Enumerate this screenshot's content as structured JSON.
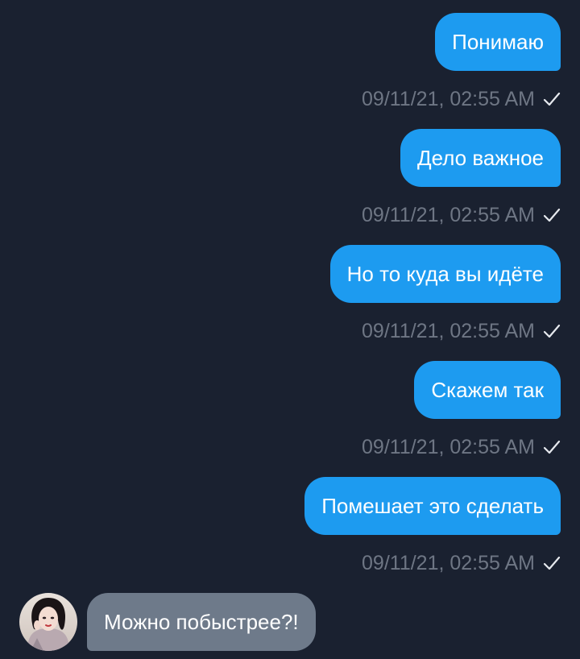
{
  "messages": [
    {
      "text": "Понимаю",
      "timestamp": "09/11/21, 02:55 AM",
      "status_icon": "check-icon"
    },
    {
      "text": "Дело важное",
      "timestamp": "09/11/21, 02:55 AM",
      "status_icon": "check-icon"
    },
    {
      "text": "Но то куда вы идёте",
      "timestamp": "09/11/21, 02:55 AM",
      "status_icon": "check-icon"
    },
    {
      "text": "Скажем так",
      "timestamp": "09/11/21, 02:55 AM",
      "status_icon": "check-icon"
    },
    {
      "text": "Помешает это сделать",
      "timestamp": "09/11/21, 02:55 AM",
      "status_icon": "check-icon"
    }
  ],
  "incoming": {
    "text": "Можно побыстрее?!",
    "avatar_icon": "user-avatar"
  },
  "colors": {
    "background": "#1a2130",
    "outgoing_bubble": "#1d9bf0",
    "incoming_bubble": "#6e7a8a",
    "timestamp": "#6e7684"
  }
}
